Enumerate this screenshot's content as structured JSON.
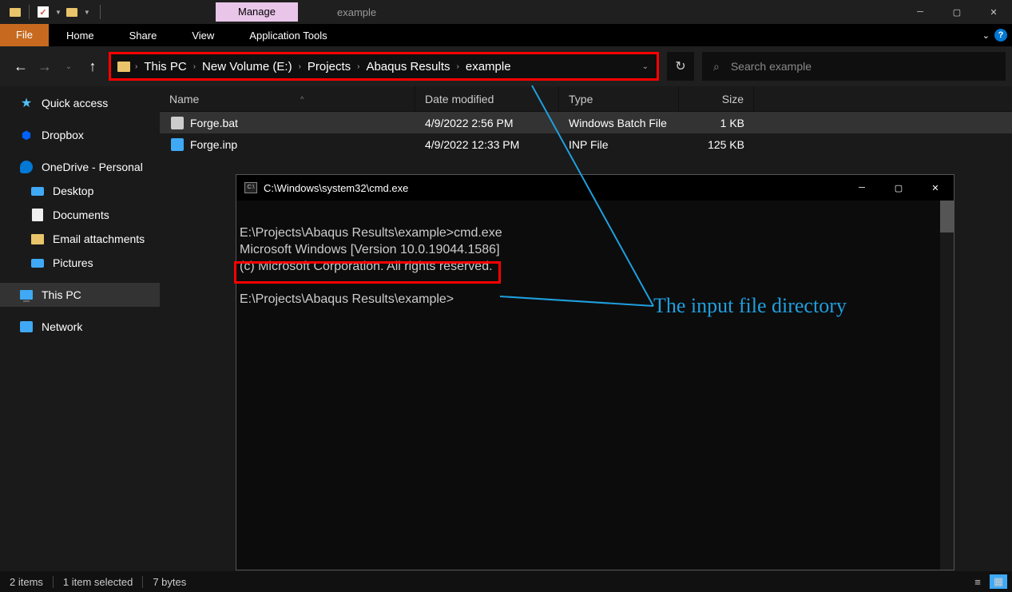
{
  "titlebar": {
    "manage_tab": "Manage",
    "title": "example"
  },
  "ribbon": {
    "file": "File",
    "tabs": [
      "Home",
      "Share",
      "View",
      "Application Tools"
    ]
  },
  "breadcrumb": [
    "This PC",
    "New Volume (E:)",
    "Projects",
    "Abaqus Results",
    "example"
  ],
  "search": {
    "placeholder": "Search example"
  },
  "sidebar": {
    "quick_access": "Quick access",
    "dropbox": "Dropbox",
    "onedrive": "OneDrive - Personal",
    "desktop": "Desktop",
    "documents": "Documents",
    "email": "Email attachments",
    "pictures": "Pictures",
    "thispc": "This PC",
    "network": "Network"
  },
  "columns": {
    "name": "Name",
    "date": "Date modified",
    "type": "Type",
    "size": "Size"
  },
  "files": [
    {
      "name": "Forge.bat",
      "date": "4/9/2022 2:56 PM",
      "type": "Windows Batch File",
      "size": "1 KB"
    },
    {
      "name": "Forge.inp",
      "date": "4/9/2022 12:33 PM",
      "type": "INP File",
      "size": "125 KB"
    }
  ],
  "cmd": {
    "title": "C:\\Windows\\system32\\cmd.exe",
    "line1": "E:\\Projects\\Abaqus Results\\example>cmd.exe",
    "line2": "Microsoft Windows [Version 10.0.19044.1586]",
    "line3": "(c) Microsoft Corporation. All rights reserved.",
    "prompt": "E:\\Projects\\Abaqus Results\\example>"
  },
  "annotation": "The input file directory",
  "status": {
    "items": "2 items",
    "selected": "1 item selected",
    "bytes": "7 bytes"
  }
}
